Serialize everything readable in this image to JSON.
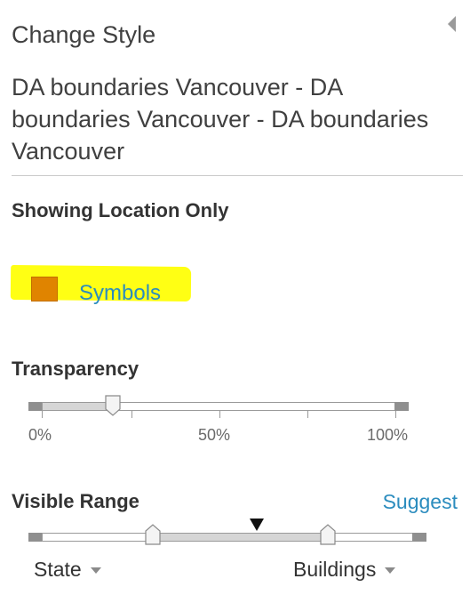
{
  "panel": {
    "step_title": "Change Style",
    "layer_title": "DA boundaries Vancouver - DA boundaries Vancouver - DA boundaries Vancouver",
    "collapse_icon": "caret-left-icon"
  },
  "style": {
    "mode_title": "Showing Location Only",
    "symbol_color": "#e08400",
    "symbols_label": "Symbols",
    "highlight_color": "#ffff14"
  },
  "transparency": {
    "title": "Transparency",
    "value_percent": 20,
    "tick_labels": [
      "0%",
      "50%",
      "100%"
    ]
  },
  "visible_range": {
    "title": "Visible Range",
    "suggest_label": "Suggest",
    "min_scale": "State",
    "max_scale": "Buildings",
    "range_start_fraction": 0.3,
    "range_end_fraction": 0.77,
    "current_scale_fraction": 0.58
  },
  "colors": {
    "link": "#2b8cbe",
    "text": "#333333",
    "muted": "#6a6a6a"
  }
}
